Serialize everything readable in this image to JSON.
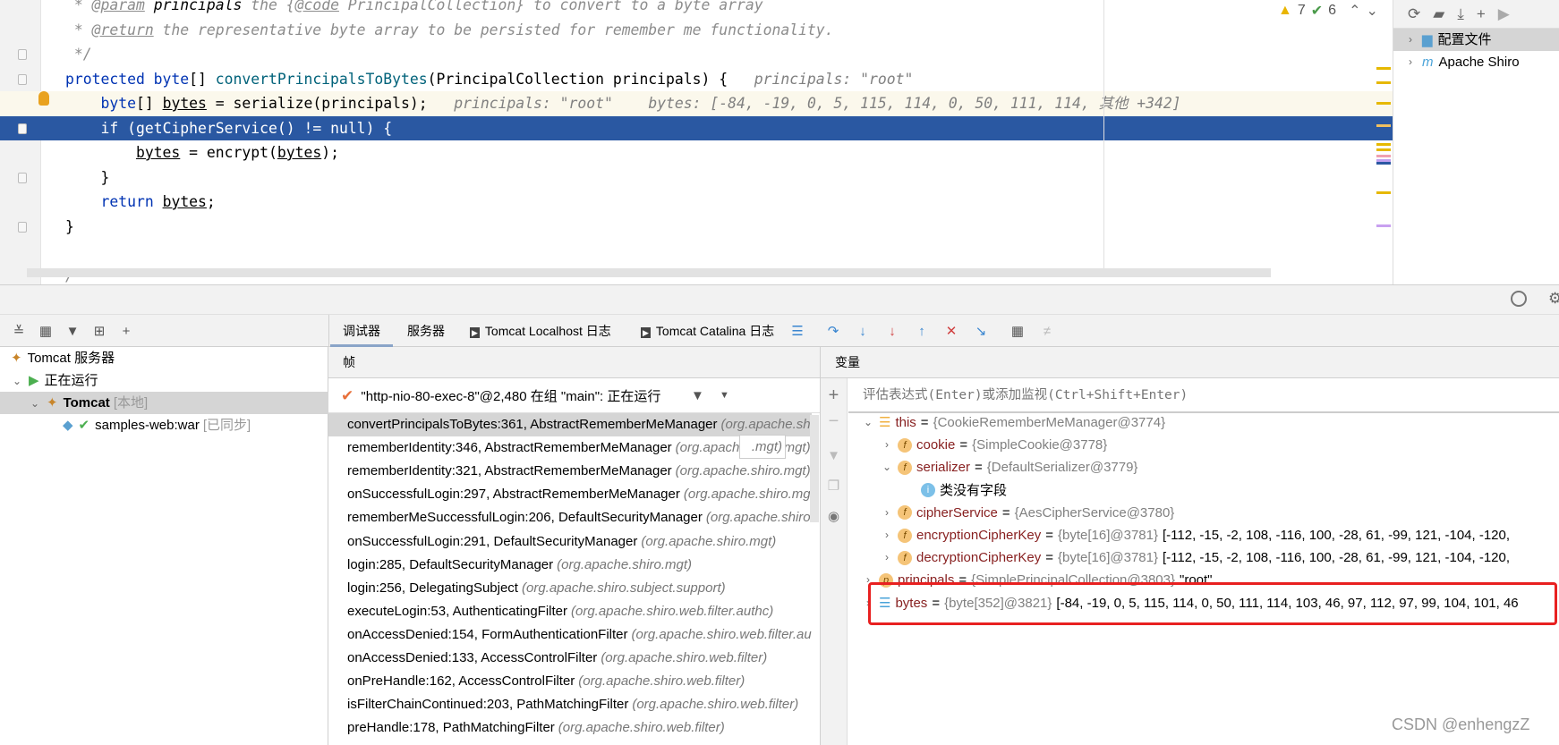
{
  "editor": {
    "lines": [
      [
        {
          "t": " * ",
          "c": "cm"
        },
        {
          "t": "@param",
          "c": "tag"
        },
        {
          "t": " principals ",
          "c": "cm pl"
        },
        {
          "t": "the {",
          "c": "cm"
        },
        {
          "t": "@code",
          "c": "tag"
        },
        {
          "t": " PrincipalCollection} to convert to a byte array",
          "c": "cm"
        }
      ],
      [
        {
          "t": " * ",
          "c": "cm"
        },
        {
          "t": "@return",
          "c": "tag"
        },
        {
          "t": " the representative byte array to be persisted for remember me functionality.",
          "c": "cm"
        }
      ],
      [
        {
          "t": " */",
          "c": "cm"
        }
      ],
      [
        {
          "t": "protected byte",
          "c": "k"
        },
        {
          "t": "[] ",
          "c": ""
        },
        {
          "t": "convertPrincipalsToBytes",
          "c": "fn"
        },
        {
          "t": "(PrincipalCollection principals) {",
          "c": ""
        },
        {
          "t": "   principals: \"root\"",
          "c": "h"
        }
      ],
      [
        {
          "t": "    ",
          "c": ""
        },
        {
          "t": "byte",
          "c": "k"
        },
        {
          "t": "[] ",
          "c": ""
        },
        {
          "t": "bytes",
          "c": "v"
        },
        {
          "t": " = serialize(principals);",
          "c": ""
        },
        {
          "t": "   principals: \"root\"    bytes: [-84, -19, 0, 5, 115, 114, 0, 50, 111, 114, 其他 +342]",
          "c": "h"
        }
      ],
      [
        {
          "t": "    ",
          "c": ""
        },
        {
          "t": "if",
          "c": "k"
        },
        {
          "t": " (getCipherService() != ",
          "c": ""
        },
        {
          "t": "null",
          "c": "k"
        },
        {
          "t": ") {",
          "c": ""
        }
      ],
      [
        {
          "t": "        ",
          "c": ""
        },
        {
          "t": "bytes",
          "c": "v"
        },
        {
          "t": " = encrypt(",
          "c": ""
        },
        {
          "t": "bytes",
          "c": "v"
        },
        {
          "t": ");",
          "c": ""
        }
      ],
      [
        {
          "t": "    }",
          "c": ""
        }
      ],
      [
        {
          "t": "    ",
          "c": ""
        },
        {
          "t": "return",
          "c": "k"
        },
        {
          "t": " ",
          "c": ""
        },
        {
          "t": "bytes",
          "c": "v"
        },
        {
          "t": ";",
          "c": ""
        }
      ],
      [
        {
          "t": "}",
          "c": ""
        }
      ],
      [],
      [
        {
          "t": "/**",
          "c": "cm"
        }
      ]
    ],
    "warnings": "7",
    "checks": "6"
  },
  "right_panel": {
    "items": [
      {
        "label": "配置文件",
        "selected": true
      },
      {
        "label": "Apache Shiro"
      }
    ]
  },
  "tabs": [
    {
      "label": "调试器",
      "active": true
    },
    {
      "label": "服务器"
    },
    {
      "label": "Tomcat Localhost 日志"
    },
    {
      "label": "Tomcat Catalina 日志"
    }
  ],
  "services": {
    "items": [
      {
        "label": "Tomcat 服务器",
        "suffix": ""
      },
      {
        "label": "正在运行",
        "suffix": ""
      },
      {
        "label": "Tomcat",
        "suffix": "[本地]",
        "selected": true
      },
      {
        "label": "samples-web:war",
        "suffix": "[已同步]"
      }
    ]
  },
  "frames": {
    "header": "帧",
    "thread": "\"http-nio-80-exec-8\"@2,480 在组 \"main\": 正在运行",
    "items": [
      {
        "m": "convertPrincipalsToBytes:361, AbstractRememberMeManager",
        "p": "(org.apache.shiro.mgt)",
        "selected": true
      },
      {
        "m": "rememberIdentity:346, AbstractRememberMeManager",
        "p": "(org.apache.shiro.mgt)"
      },
      {
        "m": "rememberIdentity:321, AbstractRememberMeManager",
        "p": "(org.apache.shiro.mgt)"
      },
      {
        "m": "onSuccessfulLogin:297, AbstractRememberMeManager",
        "p": "(org.apache.shiro.mgt)"
      },
      {
        "m": "rememberMeSuccessfulLogin:206, DefaultSecurityManager",
        "p": "(org.apache.shiro.mgt)"
      },
      {
        "m": "onSuccessfulLogin:291, DefaultSecurityManager",
        "p": "(org.apache.shiro.mgt)"
      },
      {
        "m": "login:285, DefaultSecurityManager",
        "p": "(org.apache.shiro.mgt)"
      },
      {
        "m": "login:256, DelegatingSubject",
        "p": "(org.apache.shiro.subject.support)"
      },
      {
        "m": "executeLogin:53, AuthenticatingFilter",
        "p": "(org.apache.shiro.web.filter.authc)"
      },
      {
        "m": "onAccessDenied:154, FormAuthenticationFilter",
        "p": "(org.apache.shiro.web.filter.authc)"
      },
      {
        "m": "onAccessDenied:133, AccessControlFilter",
        "p": "(org.apache.shiro.web.filter)"
      },
      {
        "m": "onPreHandle:162, AccessControlFilter",
        "p": "(org.apache.shiro.web.filter)"
      },
      {
        "m": "isFilterChainContinued:203, PathMatchingFilter",
        "p": "(org.apache.shiro.web.filter)"
      },
      {
        "m": "preHandle:178, PathMatchingFilter",
        "p": "(org.apache.shiro.web.filter)"
      }
    ],
    "tooltip": ".mgt)"
  },
  "variables": {
    "header": "变量",
    "eval_placeholder": "评估表达式(Enter)或添加监视(Ctrl+Shift+Enter)",
    "items": [
      {
        "depth": 0,
        "chev": "v",
        "icon": "object",
        "name": "this",
        "type": "{CookieRememberMeManager@3774}",
        "val": ""
      },
      {
        "depth": 1,
        "chev": ">",
        "icon": "field",
        "name": "cookie",
        "type": "{SimpleCookie@3778}",
        "val": ""
      },
      {
        "depth": 1,
        "chev": "v",
        "icon": "field",
        "name": "serializer",
        "type": "{DefaultSerializer@3779}",
        "val": ""
      },
      {
        "depth": 2,
        "chev": "",
        "icon": "info",
        "name": "类没有字段",
        "type": "",
        "val": ""
      },
      {
        "depth": 1,
        "chev": ">",
        "icon": "field",
        "name": "cipherService",
        "type": "{AesCipherService@3780}",
        "val": ""
      },
      {
        "depth": 1,
        "chev": ">",
        "icon": "field",
        "name": "encryptionCipherKey",
        "type": "{byte[16]@3781}",
        "val": "[-112, -15, -2, 108, -116, 100, -28, 61, -99, 121, -104, -120,"
      },
      {
        "depth": 1,
        "chev": ">",
        "icon": "field",
        "name": "decryptionCipherKey",
        "type": "{byte[16]@3781}",
        "val": "[-112, -15, -2, 108, -116, 100, -28, 61, -99, 121, -104, -120,"
      },
      {
        "depth": 0,
        "chev": ">",
        "icon": "param",
        "name": "principals",
        "type": "{SimplePrincipalCollection@3803}",
        "val": "\"root\""
      },
      {
        "depth": 0,
        "chev": ">",
        "icon": "array",
        "name": "bytes",
        "type": "{byte[352]@3821}",
        "val": "[-84, -19, 0, 5, 115, 114, 0, 50, 111, 114, 103, 46, 97, 112, 97, 99, 104, 101, 46",
        "highlighted": true
      }
    ]
  },
  "watermark": "CSDN @enhengzZ",
  "colors": {
    "selection": "#2a58a2",
    "current_line": "#fbf8ec",
    "highlight_box": "#e82020"
  }
}
